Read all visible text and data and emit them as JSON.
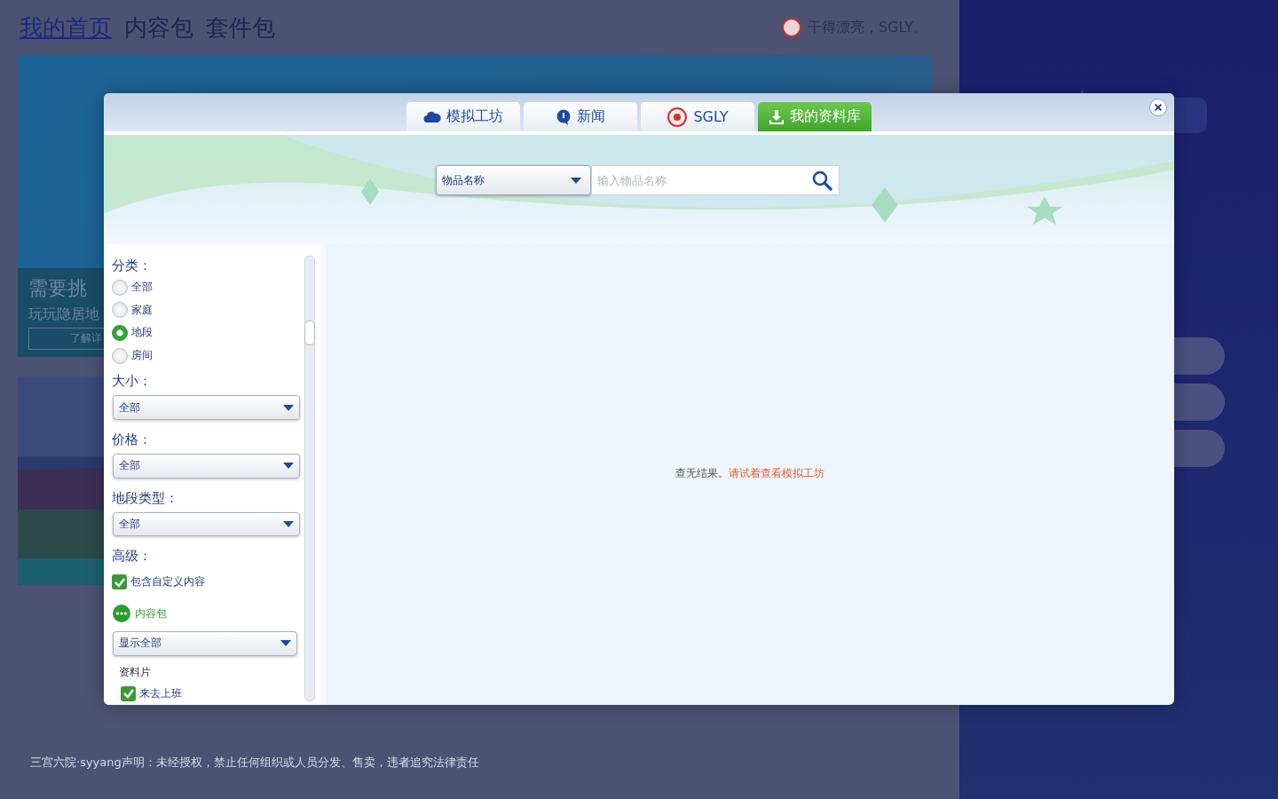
{
  "nav": {
    "links": [
      {
        "label": "我的首页",
        "selected": true
      },
      {
        "label": "内容包",
        "selected": false
      },
      {
        "label": "套件包",
        "selected": false
      }
    ],
    "greeting": "干得漂亮，SGLY。"
  },
  "promo": {
    "title": "需要挑",
    "subtitle": "玩玩隐居地",
    "button": "了解详"
  },
  "footer_notice": "三宫六院·syyang声明：未经授权，禁止任何组织或人员分发、售卖，违者追究法律责任",
  "dialog": {
    "tabs": [
      {
        "label": "模拟工坊",
        "kind": "cloud",
        "selected": false
      },
      {
        "label": "新闻",
        "kind": "news",
        "selected": false
      },
      {
        "label": "SGLY",
        "kind": "logo",
        "selected": false
      },
      {
        "label": "我的资料库",
        "kind": "download",
        "selected": true
      }
    ],
    "search": {
      "scope": "物品名称",
      "placeholder": "输入物品名称"
    },
    "filters": {
      "category": {
        "label": "分类：",
        "options": [
          {
            "label": "全部",
            "selected": false
          },
          {
            "label": "家庭",
            "selected": false
          },
          {
            "label": "地段",
            "selected": true
          },
          {
            "label": "房间",
            "selected": false
          }
        ]
      },
      "selects": [
        {
          "label": "大小：",
          "value": "全部"
        },
        {
          "label": "价格：",
          "value": "全部"
        },
        {
          "label": "地段类型：",
          "value": "全部"
        }
      ],
      "advanced": {
        "label": "高级：",
        "custom_content": {
          "label": "包含自定义内容",
          "checked": true
        },
        "packs": {
          "label": "内容包",
          "value": "显示全部"
        },
        "expansions": {
          "label": "资料片",
          "items": [
            {
              "label": "来去上班",
              "checked": true
            }
          ]
        }
      }
    },
    "results": {
      "message": "查无结果。",
      "link": "请试着查看模拟工坊"
    }
  }
}
